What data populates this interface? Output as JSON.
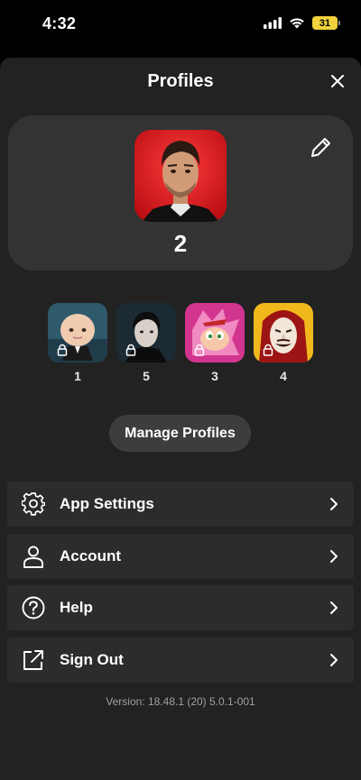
{
  "status_bar": {
    "time": "4:32",
    "battery": "31"
  },
  "sheet": {
    "title": "Profiles"
  },
  "active_profile": {
    "name": "2"
  },
  "profiles": [
    {
      "label": "1"
    },
    {
      "label": "5"
    },
    {
      "label": "3"
    },
    {
      "label": "4"
    }
  ],
  "manage_button": "Manage Profiles",
  "menu": [
    {
      "label": "App Settings",
      "icon": "gear-icon"
    },
    {
      "label": "Account",
      "icon": "person-icon"
    },
    {
      "label": "Help",
      "icon": "question-icon"
    },
    {
      "label": "Sign Out",
      "icon": "external-link-icon"
    }
  ],
  "version": "Version: 18.48.1 (20) 5.0.1-001",
  "colors": {
    "background": "#000000",
    "sheet": "#222222",
    "card": "#333333",
    "menu_item": "#2c2c2c",
    "battery": "#f2d23c",
    "active_avatar_bg": "#e3151c"
  }
}
